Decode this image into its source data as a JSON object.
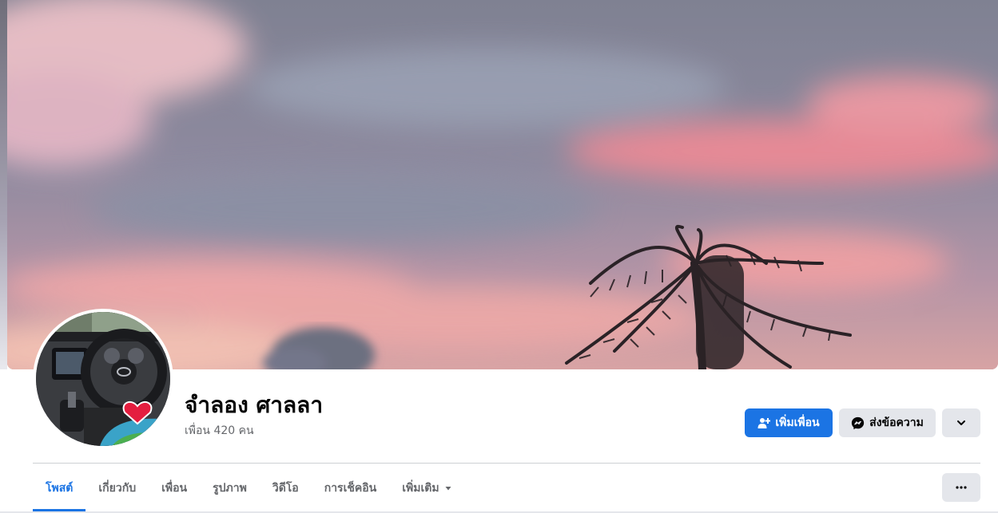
{
  "profile": {
    "name": "จำลอง ศาลลา",
    "friends_text": "เพื่อน 420 คน"
  },
  "actions": {
    "add_friend_label": "เพิ่มเพื่อน",
    "message_label": "ส่งข้อความ"
  },
  "tabs": [
    {
      "label": "โพสต์",
      "active": true
    },
    {
      "label": "เกี่ยวกับ",
      "active": false
    },
    {
      "label": "เพื่อน",
      "active": false
    },
    {
      "label": "รูปภาพ",
      "active": false
    },
    {
      "label": "วิดีโอ",
      "active": false
    },
    {
      "label": "การเช็คอิน",
      "active": false
    },
    {
      "label": "เพิ่มเติม",
      "active": false
    }
  ],
  "icons": {
    "add_friend": "person-plus-icon",
    "messenger": "messenger-icon",
    "chevron": "chevron-down-icon",
    "caret": "caret-down-icon",
    "more": "more-horizontal-icon"
  },
  "colors": {
    "accent": "#1b74e4",
    "secondary_button": "#e4e6eb",
    "text_primary": "#050505",
    "text_secondary": "#65676b"
  }
}
